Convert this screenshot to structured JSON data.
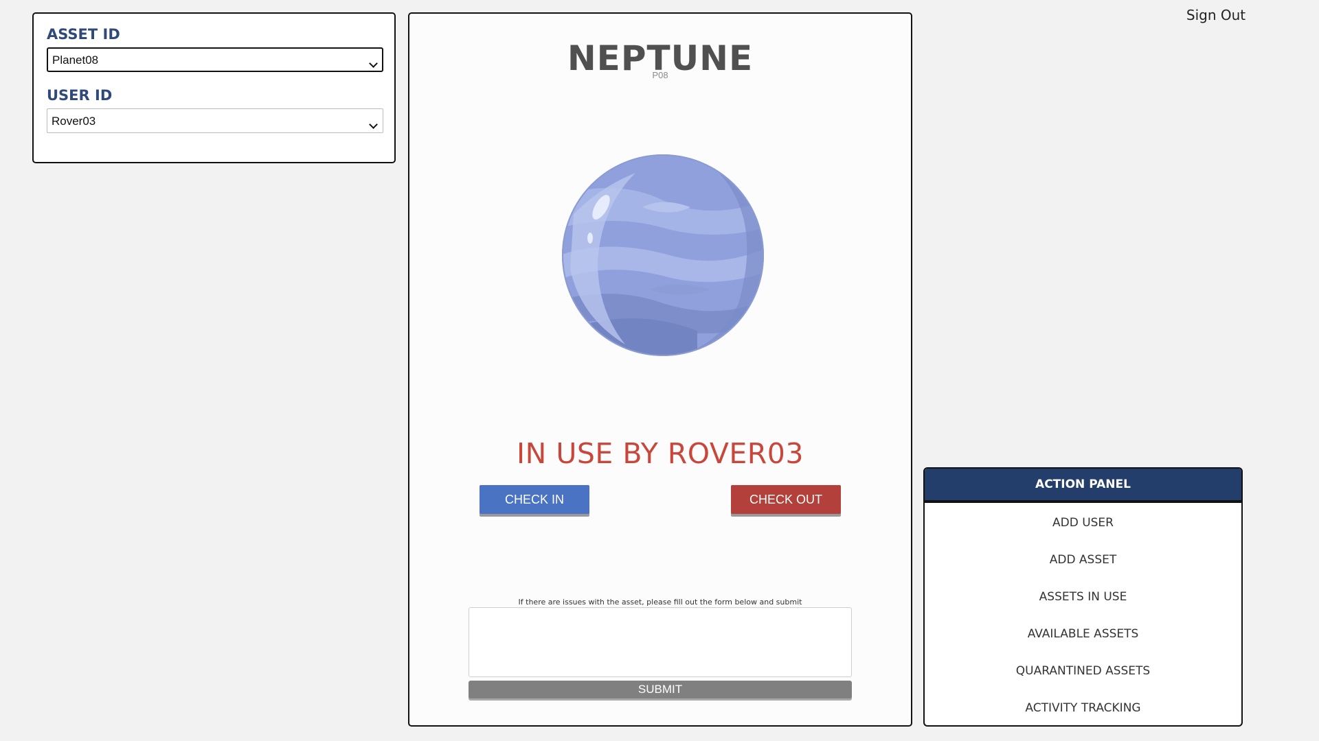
{
  "asset_selector": {
    "asset_label": "ASSET ID",
    "asset_value": "Planet08",
    "user_label": "USER ID",
    "user_value": "Rover03"
  },
  "asset": {
    "name": "NEPTUNE",
    "code": "P08",
    "image_icon": "neptune-planet",
    "status": "IN USE BY ROVER03",
    "status_color": "#c9463a"
  },
  "buttons": {
    "check_in": "CHECK IN",
    "check_out": "CHECK OUT",
    "submit": "SUBMIT"
  },
  "issue_form": {
    "hint": "If there are issues with the asset, please fill out the form below and submit",
    "value": ""
  },
  "header": {
    "sign_out": "Sign Out"
  },
  "action_panel": {
    "title": "ACTION PANEL",
    "items": [
      "ADD USER",
      "ADD ASSET",
      "ASSETS IN USE",
      "AVAILABLE ASSETS",
      "QUARANTINED ASSETS",
      "ACTIVITY TRACKING"
    ]
  },
  "colors": {
    "label_blue": "#2f4a7a",
    "check_in_blue": "#4a73c3",
    "check_out_red": "#b3403a",
    "panel_header": "#243e6c",
    "submit_gray": "#808080"
  }
}
